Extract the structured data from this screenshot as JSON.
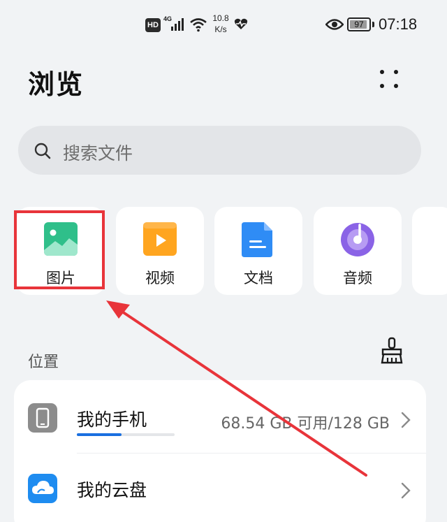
{
  "status_bar": {
    "hd_label": "HD",
    "network_label": "4G",
    "speed_value": "10.8",
    "speed_unit": "K/s",
    "battery_level": "97",
    "time": "07:18",
    "icons": [
      "signal-icon",
      "wifi-icon",
      "heart-rate-icon",
      "eye-comfort-icon",
      "battery-icon"
    ]
  },
  "header": {
    "title": "浏览",
    "more_icon": "more-dots-icon"
  },
  "search": {
    "placeholder": "搜索文件",
    "icon": "search-icon"
  },
  "categories": [
    {
      "label": "图片",
      "icon": "image-icon",
      "color": "#2fbf8a",
      "highlighted": true
    },
    {
      "label": "视频",
      "icon": "video-icon",
      "color": "#ffa51f"
    },
    {
      "label": "文档",
      "icon": "document-icon",
      "color": "#2f8cf5"
    },
    {
      "label": "音频",
      "icon": "audio-icon",
      "color": "#8a63e6"
    }
  ],
  "locations": {
    "section_label": "位置",
    "clean_icon": "clean-broom-icon",
    "items": [
      {
        "label": "我的手机",
        "detail": "68.54 GB 可用/128 GB",
        "icon": "phone-icon",
        "storage_used_fraction": 0.46
      },
      {
        "label": "我的云盘",
        "detail": "",
        "icon": "cloud-icon"
      }
    ]
  },
  "colors": {
    "accent": "#1a6fe0",
    "highlight": "#e8343a",
    "background": "#f1f3f5"
  }
}
